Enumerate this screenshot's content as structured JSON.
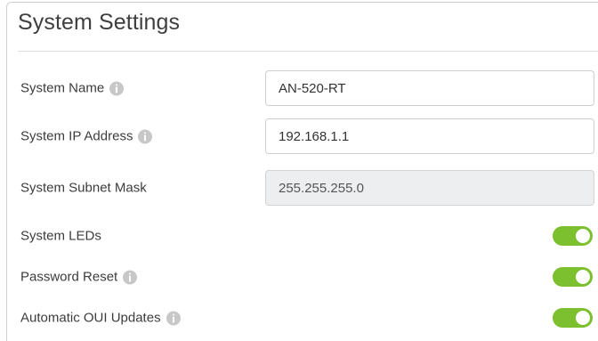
{
  "panel": {
    "title": "System Settings"
  },
  "fields": {
    "system_name": {
      "label": "System Name",
      "value": "AN-520-RT"
    },
    "system_ip": {
      "label": "System IP Address",
      "value": "192.168.1.1"
    },
    "subnet_mask": {
      "label": "System Subnet Mask",
      "value": "255.255.255.0",
      "disabled": true
    }
  },
  "toggles": {
    "system_leds": {
      "label": "System LEDs",
      "enabled": true
    },
    "password_reset": {
      "label": "Password Reset",
      "enabled": true
    },
    "auto_oui_updates": {
      "label": "Automatic OUI Updates",
      "enabled": true
    }
  },
  "colors": {
    "toggle_on": "#7cbf2f",
    "info_icon": "#c8c8c8",
    "disabled_input_bg": "#eceeef"
  },
  "icons": {
    "info": "info-icon"
  }
}
